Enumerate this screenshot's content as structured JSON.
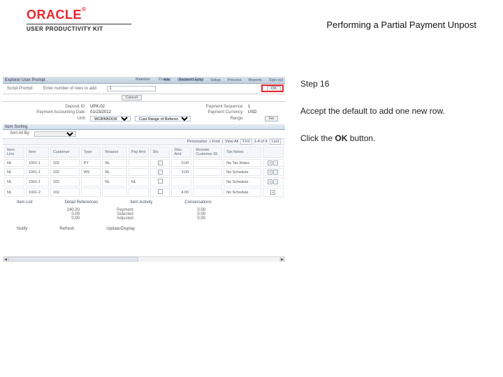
{
  "brand": {
    "name": "ORACLE",
    "tm": "®",
    "product_line": "USER PRODUCTIVITY KIT"
  },
  "page_title": "Performing a Partial Payment Unpost",
  "instructions": {
    "step_label": "Step 16",
    "line1": "Accept the default to add one new row.",
    "line2_pre": "Click the ",
    "line2_bold": "OK",
    "line2_post": " button."
  },
  "app": {
    "window_title": "Explorer User Prompt",
    "crumb1": "Maintain",
    "crumb2": "Create",
    "crumb3": "Payment Entry",
    "topnav": [
      "Add",
      "Update/Display",
      "Setup",
      "Process",
      "Reports",
      "Sign out"
    ],
    "dialog": {
      "label": "Script Prompt:",
      "prompt_text": "Enter number of rows to add:",
      "value": "1",
      "ok_label": "OK",
      "cancel_label": "Cancel"
    },
    "header_fields": {
      "deposit_id_k": "Deposit ID:",
      "deposit_id_v": "UPK-02",
      "accounting_date_k": "Payment Accounting Date:",
      "accounting_date_v": "01/23/2012",
      "unit_k": "Unit:",
      "unit_v": "WORKBOOK",
      "cust_range_k": "Cust Range of References",
      "payment_seq_k": "Payment Sequence:",
      "payment_seq_v": "1",
      "payment_currency_k": "Payment Currency:",
      "payment_currency_v": "USD",
      "range_k": "Range:",
      "go_label": "Go"
    },
    "section_title": "Item Sorting",
    "sort_label": "Sort All By:",
    "nav": {
      "personalize": "Personalize",
      "find": "Find",
      "view_all": "View All",
      "count": "1-4 of 4",
      "first": "First",
      "last": "Last"
    },
    "grid": {
      "headers": [
        "Item Line",
        "Item",
        "Customer",
        "Type",
        "Reason",
        "Pay Amt",
        "Sts",
        "Disc Amt",
        "Remote Customer ID",
        "Tax Notes",
        ""
      ],
      "rows": [
        {
          "line": "NL",
          "item": "1001-1",
          "customer": "102",
          "type": "PY",
          "reason": "NL",
          "pay": "",
          "sel": 1,
          "disc": "0.00",
          "remote": "",
          "tax": "No Tax Notes",
          "act": "±"
        },
        {
          "line": "NL",
          "item": "1001-1",
          "customer": "102",
          "type": "WS",
          "reason": "NL",
          "pay": "",
          "sel": 1,
          "disc": "3.00",
          "remote": "",
          "tax": "No Schedule",
          "act": "±"
        },
        {
          "line": "NL",
          "item": "1001-1",
          "customer": "102",
          "type": "",
          "reason": "NL",
          "pay": "NL",
          "sel": 0,
          "disc": "",
          "remote": "",
          "tax": "No Schedule",
          "act": "±"
        },
        {
          "line": "NL",
          "item": "1001-2",
          "customer": "102",
          "type": "",
          "reason": "",
          "pay": "",
          "sel": 0,
          "disc": "4.00",
          "remote": "",
          "tax": "No Schedule",
          "act": "+"
        }
      ]
    },
    "secondary_links": {
      "item_list": "Item List",
      "dist_code": "Detail References",
      "conversations": "Item Activity",
      "later_actions": "Conversations"
    },
    "totals": [
      {
        "a": "240.20",
        "b": "Payment",
        "c": "0.00"
      },
      {
        "a": "0.00",
        "b": "Selected",
        "c": "0.00"
      },
      {
        "a": "0.00",
        "b": "Adjusted",
        "c": "0.00"
      }
    ],
    "footer": {
      "a": "Notify",
      "b": "Refresh",
      "c": "Update/Display"
    }
  }
}
